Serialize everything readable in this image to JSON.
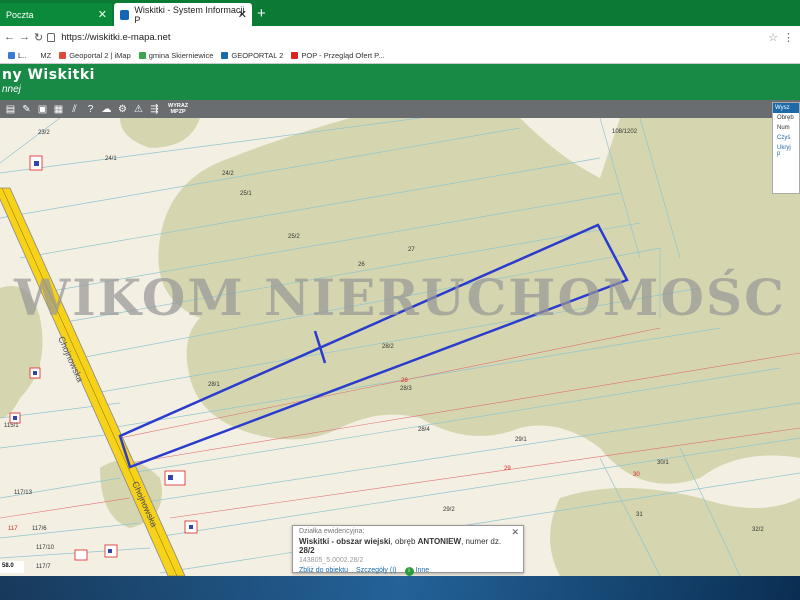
{
  "browser": {
    "tabs": [
      {
        "label": "Poczta",
        "active": false
      },
      {
        "label": "Wiskitki - System Informacji P",
        "active": true
      }
    ],
    "new_tab": "+",
    "url": "https://wiskitki.e-mapa.net",
    "bookmarks": [
      {
        "label": "L.."
      },
      {
        "label": "MZ"
      },
      {
        "label": "Geoportal 2 | iMap"
      },
      {
        "label": "gmina Skierniewice"
      },
      {
        "label": "GEOPORTAL 2"
      },
      {
        "label": "POP - Przegląd Ofert P..."
      }
    ]
  },
  "app": {
    "title": "ny Wiskitki",
    "subtitle": "nnej",
    "toolbar_wyraz": "WYRAZ",
    "toolbar_mpzp": "MPZP"
  },
  "map": {
    "watermark": "WIKOM NIERUCHOMOŚC",
    "road_label_1": "Chojnowska",
    "road_label_2": "Chojnowska",
    "parcels": {
      "p23_2": "23/2",
      "p24_1": "24/1",
      "p24_2": "24/2",
      "p25_1": "25/1",
      "p25_2": "25/2",
      "p26": "26",
      "p27": "27",
      "p28_2": "28/2",
      "p28_1": "28/1",
      "p28_red": "28",
      "p28_3": "28/3",
      "p28_4": "28/4",
      "p29_1": "29/1",
      "p29_red": "29",
      "p29_2": "29/2",
      "p30_red": "30",
      "p30_1": "30/1",
      "p31": "31",
      "p32_2": "32/2",
      "p108": "108/1202",
      "p115_1": "115/1",
      "p117_13": "117/13",
      "p117_red": "117",
      "p117_6": "117/6",
      "p117_10": "117/10",
      "p117_7": "117/7"
    },
    "scale": "58.0"
  },
  "right_panel": {
    "head": "Wysz",
    "row1": "Obręb",
    "row2": "Num",
    "link": "Czyś",
    "footer": "Ukryj p"
  },
  "popup": {
    "title": "Działka ewidencyjna:",
    "line_prefix": "Wiskitki - obszar wiejski",
    "line_obreb": ", obręb ",
    "obreb": "ANTONIEW",
    "line_numer": ", numer dz.",
    "numer": "28/2",
    "identifier": "143805_5.0002.28/2",
    "zoom_link": "Zbliż do obiektu",
    "details_link": "Szczegóły (I)",
    "other_link": "Inne",
    "close": "✕"
  }
}
